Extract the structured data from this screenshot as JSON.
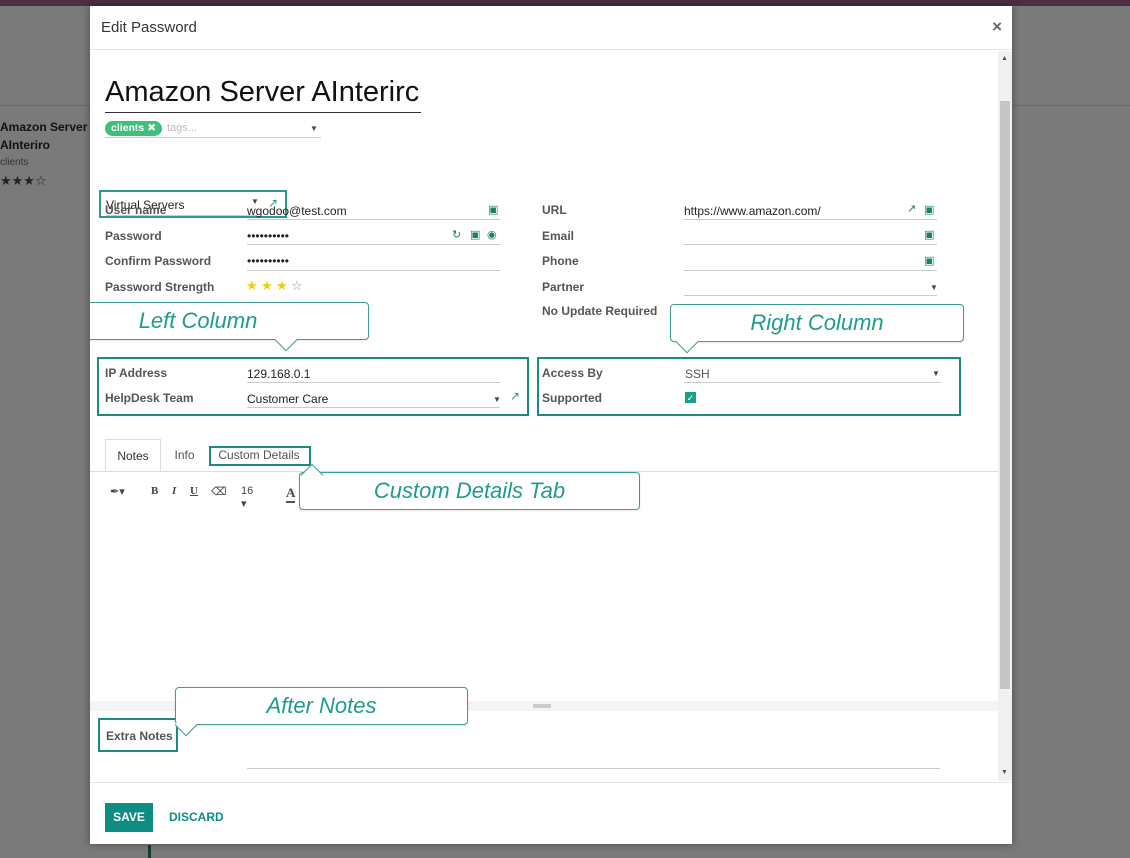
{
  "background": {
    "card_title": "Amazon Server AInteriro",
    "card_tag": "clients",
    "card_stars": "★★★☆"
  },
  "modal": {
    "title": "Edit Password",
    "close_glyph": "×"
  },
  "record": {
    "name": "Amazon Server AInterirc",
    "tags": [
      "clients"
    ],
    "tag_remove_glyph": "✖",
    "tags_placeholder": "tags...",
    "category": "Virtual Servers"
  },
  "left_fields": [
    {
      "label": "User name",
      "value": "wgodoo@test.com"
    },
    {
      "label": "Password",
      "value": "••••••••••"
    },
    {
      "label": "Confirm Password",
      "value": "••••••••••"
    },
    {
      "label": "Password Strength",
      "value": ""
    }
  ],
  "password_strength": {
    "stars_filled": 3,
    "stars_total": 4
  },
  "right_fields": [
    {
      "label": "URL",
      "value": "https://www.amazon.com/"
    },
    {
      "label": "Email",
      "value": ""
    },
    {
      "label": "Phone",
      "value": ""
    },
    {
      "label": "Partner",
      "value": ""
    },
    {
      "label": "No Update Required",
      "value": ""
    }
  ],
  "no_update_required_checked": false,
  "left_column": [
    {
      "label": "IP Address",
      "value": "129.168.0.1"
    },
    {
      "label": "HelpDesk Team",
      "value": "Customer Care"
    }
  ],
  "right_column": [
    {
      "label": "Access By",
      "value": "SSH"
    },
    {
      "label": "Supported",
      "value": ""
    }
  ],
  "supported_checked": true,
  "callouts": {
    "left": "Left Column",
    "right": "Right Column",
    "tab": "Custom Details Tab",
    "after_notes": "After Notes"
  },
  "tabs": [
    {
      "label": "Notes",
      "active": true
    },
    {
      "label": "Info",
      "active": false
    },
    {
      "label": "Custom Details",
      "active": false
    }
  ],
  "editor_toolbar": {
    "font_size": "16",
    "bold": "B",
    "italic": "I",
    "underline": "U",
    "text_color": "A"
  },
  "extra_notes_label": "Extra Notes",
  "footer": {
    "save": "SAVE",
    "discard": "DISCARD"
  },
  "colors": {
    "accent": "#0e8d83",
    "highlight": "#1e8a7b",
    "tag": "#3ec07a",
    "star": "#f3cc00",
    "topbar": "#4b2d45"
  }
}
